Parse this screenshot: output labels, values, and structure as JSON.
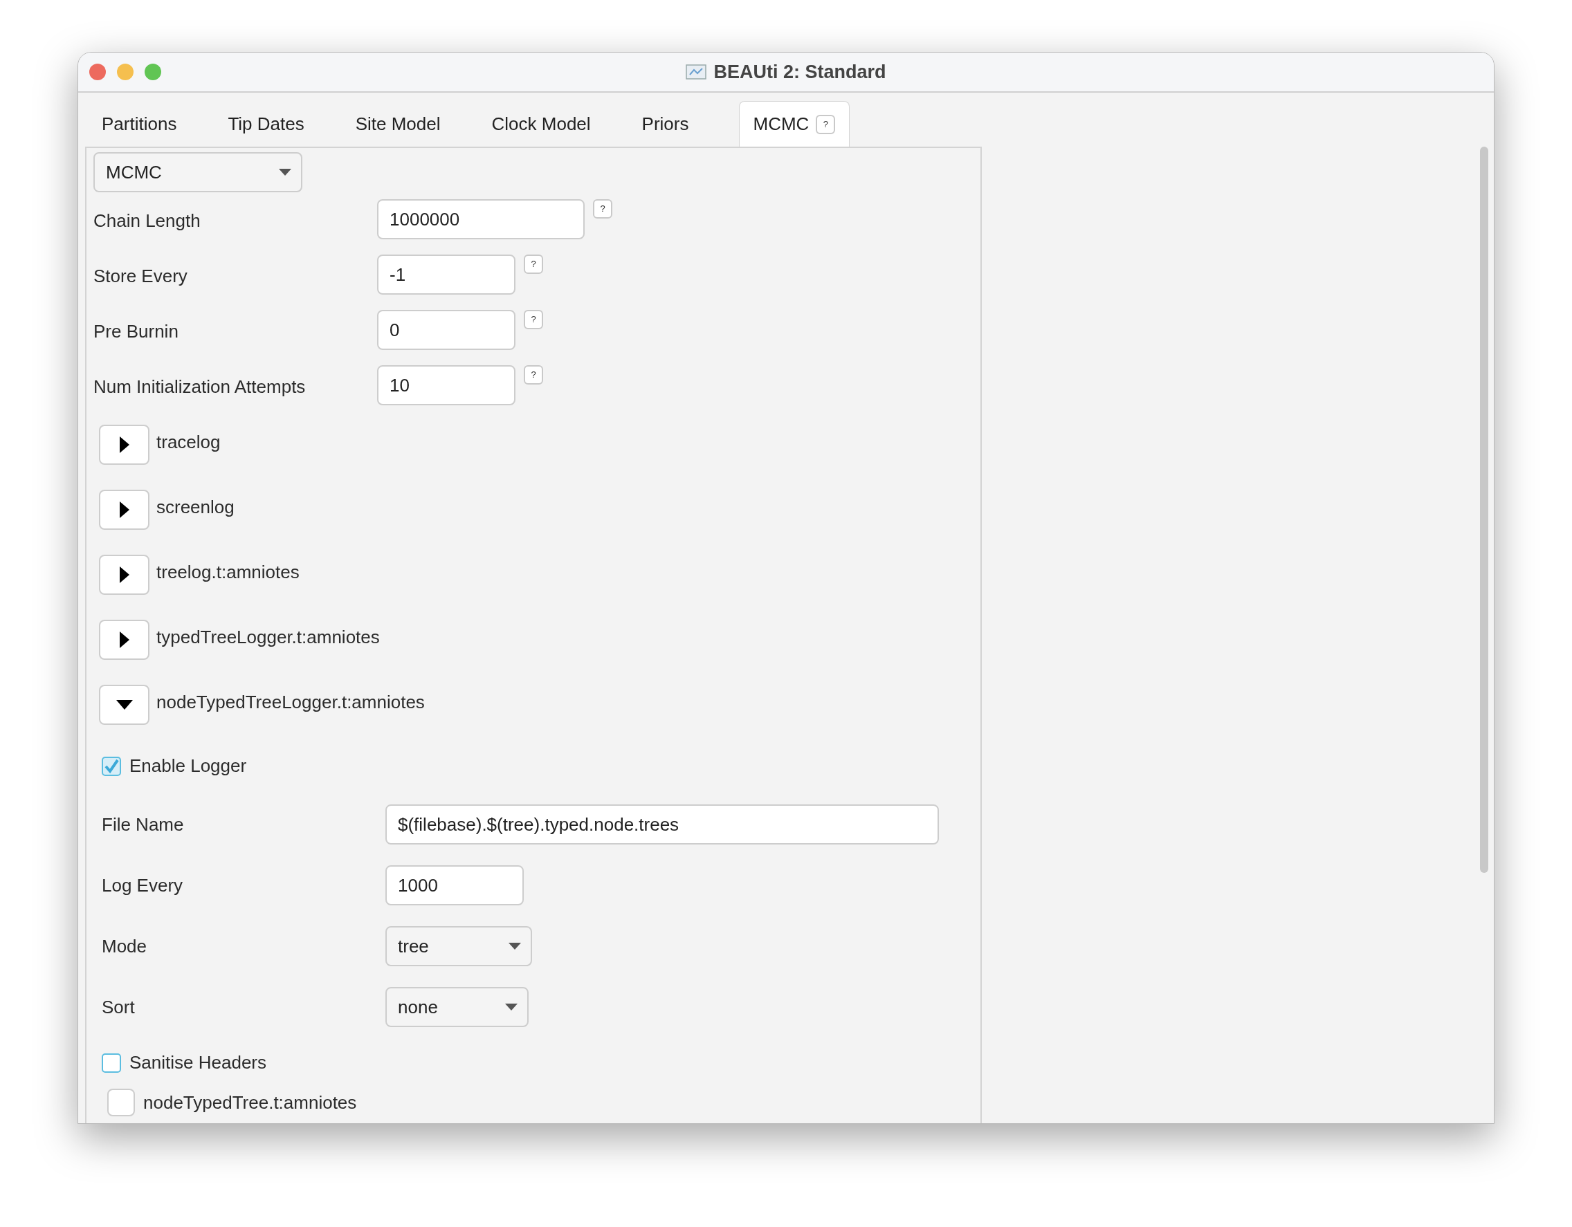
{
  "window": {
    "title": "BEAUti 2: Standard"
  },
  "tabs": [
    {
      "label": "Partitions",
      "selected": false
    },
    {
      "label": "Tip Dates",
      "selected": false
    },
    {
      "label": "Site Model",
      "selected": false
    },
    {
      "label": "Clock Model",
      "selected": false
    },
    {
      "label": "Priors",
      "selected": false
    },
    {
      "label": "MCMC",
      "selected": true,
      "help": "?"
    }
  ],
  "mcmc_select": {
    "value": "MCMC"
  },
  "parameters": [
    {
      "label": "Chain Length",
      "value": "1000000",
      "help": "?"
    },
    {
      "label": "Store Every",
      "value": "-1",
      "help": "?"
    },
    {
      "label": "Pre Burnin",
      "value": "0",
      "help": "?"
    },
    {
      "label": "Num Initialization Attempts",
      "value": "10",
      "help": "?"
    }
  ],
  "loggers": [
    {
      "label": "tracelog",
      "expanded": false
    },
    {
      "label": "screenlog",
      "expanded": false
    },
    {
      "label": "treelog.t:amniotes",
      "expanded": false
    },
    {
      "label": "typedTreeLogger.t:amniotes",
      "expanded": false
    },
    {
      "label": "nodeTypedTreeLogger.t:amniotes",
      "expanded": true
    }
  ],
  "logger_settings": {
    "enable": {
      "label": "Enable Logger",
      "checked": true
    },
    "fields": [
      {
        "kind": "text",
        "label": "File Name",
        "value": "$(filebase).$(tree).typed.node.trees"
      },
      {
        "kind": "text",
        "label": "Log Every",
        "value": "1000"
      },
      {
        "kind": "select",
        "label": "Mode",
        "value": "tree"
      },
      {
        "kind": "select",
        "label": "Sort",
        "value": "none"
      }
    ],
    "sanitise": {
      "label": "Sanitise Headers",
      "checked": false
    }
  },
  "next_item": {
    "label": "nodeTypedTree.t:amniotes",
    "checked": false
  }
}
